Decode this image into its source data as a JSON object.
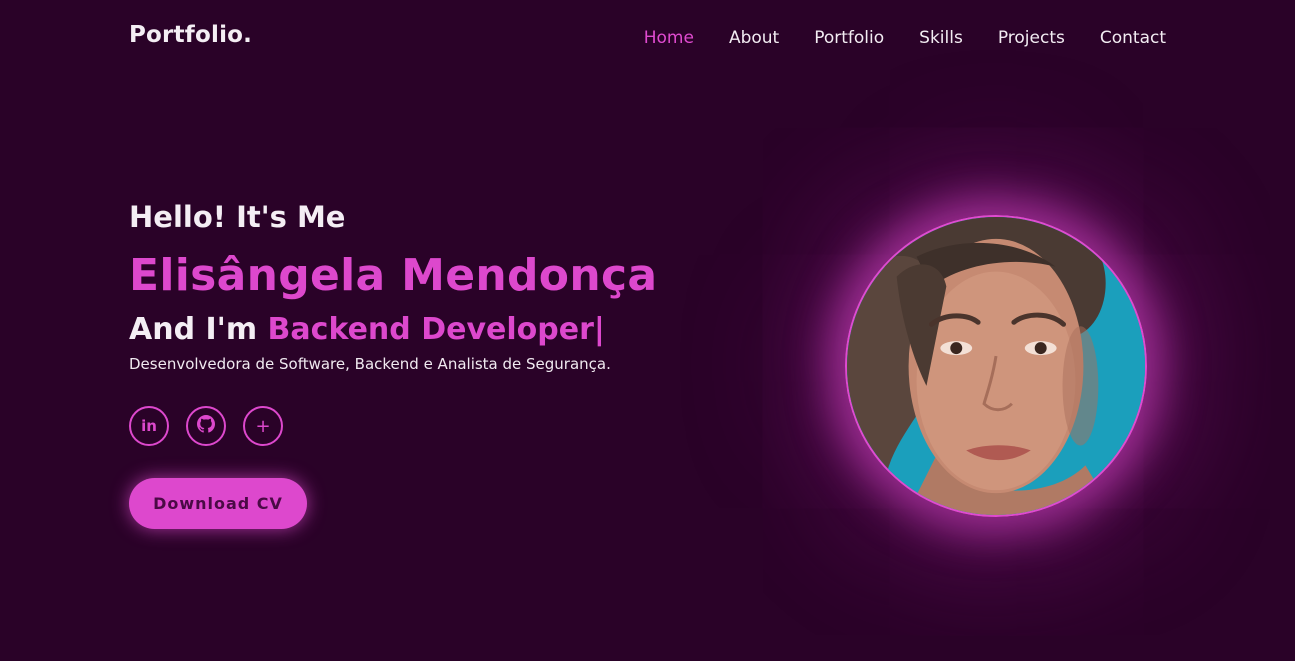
{
  "header": {
    "logo": "Portfolio.",
    "nav": [
      {
        "label": "Home",
        "active": true
      },
      {
        "label": "About",
        "active": false
      },
      {
        "label": "Portfolio",
        "active": false
      },
      {
        "label": "Skills",
        "active": false
      },
      {
        "label": "Projects",
        "active": false
      },
      {
        "label": "Contact",
        "active": false
      }
    ]
  },
  "hero": {
    "greeting": "Hello! It's Me",
    "name": "Elisângela Mendonça",
    "role_prefix": "And I'm ",
    "role_highlight": "Backend Developer",
    "role_caret": "|",
    "description": "Desenvolvedora de Software, Backend e Analista de Segurança.",
    "socials": [
      {
        "icon": "linkedin-icon",
        "glyph": "in"
      },
      {
        "icon": "github-icon",
        "glyph": ""
      },
      {
        "icon": "plus-icon",
        "glyph": "+"
      }
    ],
    "cv_button": "Download CV"
  },
  "colors": {
    "background": "#2a0228",
    "accent": "#dd48cd",
    "text": "#f4eef4"
  }
}
